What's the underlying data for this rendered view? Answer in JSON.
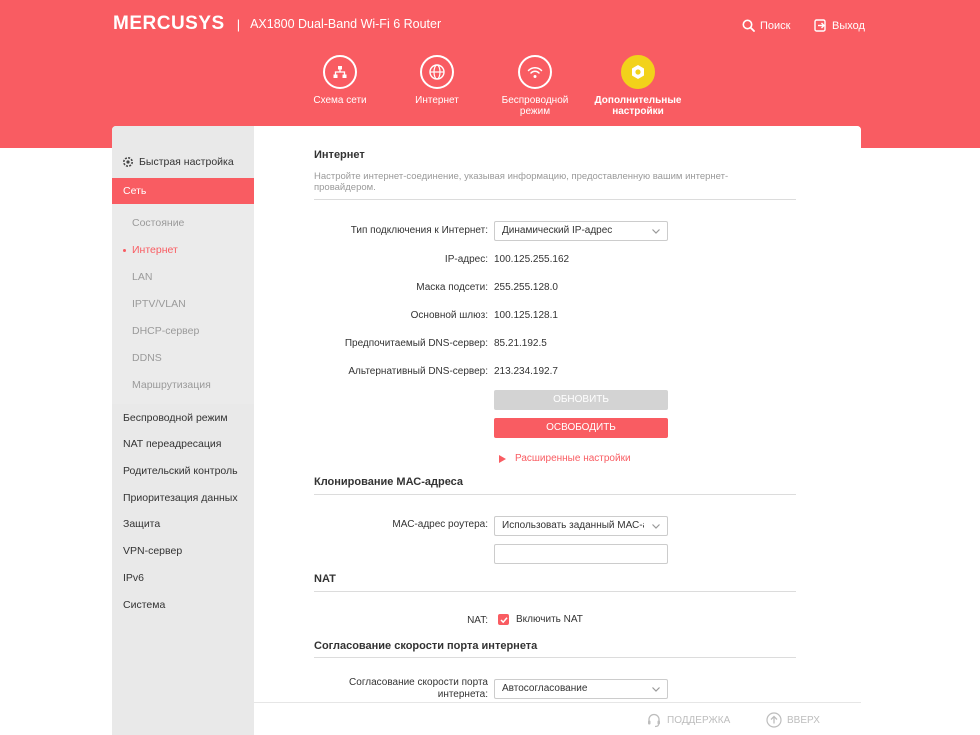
{
  "header": {
    "logo": "MERCUSYS",
    "separator": "|",
    "model": "AX1800 Dual-Band Wi-Fi 6 Router",
    "search_label": "Поиск",
    "logout_label": "Выход"
  },
  "nav": {
    "items": [
      {
        "label": "Схема сети",
        "icon": "network-map-icon"
      },
      {
        "label": "Интернет",
        "icon": "globe-icon"
      },
      {
        "label": "Беспроводной режим",
        "icon": "wifi-icon"
      },
      {
        "label": "Дополнительные настройки",
        "icon": "gear-icon",
        "active": true
      }
    ]
  },
  "sidebar": {
    "quick_setup": "Быстрая настройка",
    "active_section": "Сеть",
    "subitems": [
      "Состояние",
      "Интернет",
      "LAN",
      "IPTV/VLAN",
      "DHCP-сервер",
      "DDNS",
      "Маршрутизация"
    ],
    "current_subitem": "Интернет",
    "items": [
      "Беспроводной режим",
      "NAT переадресация",
      "Родительский контроль",
      "Приоритезация данных",
      "Защита",
      "VPN-сервер",
      "IPv6",
      "Система"
    ]
  },
  "internet": {
    "title": "Интернет",
    "description": "Настройте интернет-соединение, указывая информацию, предоставленную вашим интернет-провайдером.",
    "connection_type_label": "Тип подключения к Интернет:",
    "connection_type_value": "Динамический IP-адрес",
    "ip_label": "IP-адрес:",
    "ip_value": "100.125.255.162",
    "mask_label": "Маска подсети:",
    "mask_value": "255.255.128.0",
    "gateway_label": "Основной шлюз:",
    "gateway_value": "100.125.128.1",
    "dns1_label": "Предпочитаемый DNS-сервер:",
    "dns1_value": "85.21.192.5",
    "dns2_label": "Альтернативный DNS-сервер:",
    "dns2_value": "213.234.192.7",
    "renew_label": "ОБНОВИТЬ",
    "release_label": "ОСВОБОДИТЬ",
    "advanced_label": "Расширенные настройки"
  },
  "mac_clone": {
    "title": "Клонирование МАС-адреса",
    "mac_label": "МАС-адрес роутера:",
    "mac_value": "Использовать заданный МАС-а",
    "mac_input_value": ""
  },
  "nat": {
    "title": "NAT",
    "nat_label": "NAT:",
    "nat_checkbox_label": "Включить NAT",
    "nat_enabled": true
  },
  "speed": {
    "title": "Согласование скорости порта интернета",
    "speed_label_line1": "Согласование скорости порта",
    "speed_label_line2": "интернета:",
    "speed_value": "Автосогласование"
  },
  "footer": {
    "support_label": "ПОДДЕРЖКА",
    "top_label": "ВВЕРХ"
  },
  "colors": {
    "accent": "#f95c62",
    "active_nav": "#f2d21a",
    "sidebar_bg": "#e9e9e9"
  }
}
